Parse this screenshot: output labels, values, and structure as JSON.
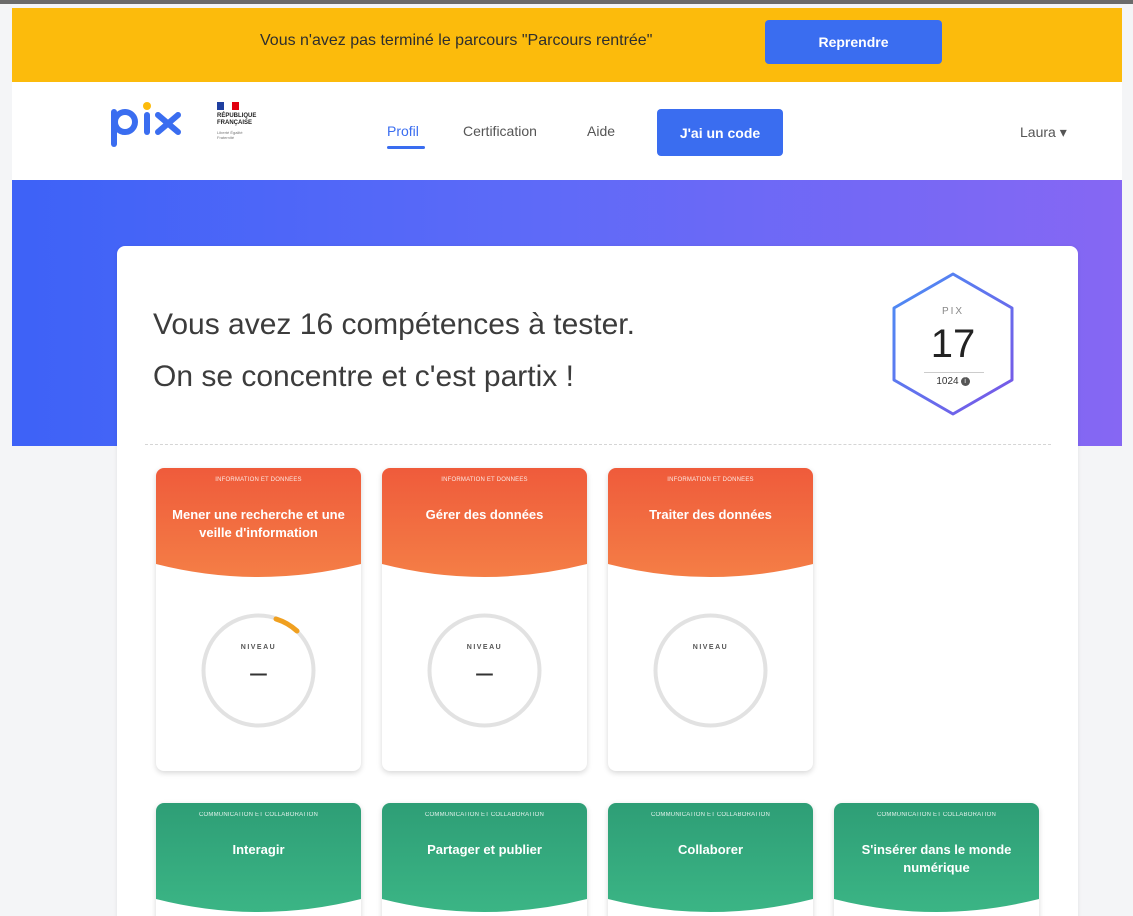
{
  "banner": {
    "message": "Vous n'avez pas terminé le parcours \"Parcours rentrée\"",
    "button": "Reprendre",
    "bg_color": "#fcbb0c"
  },
  "header": {
    "logo": "pix",
    "republic": {
      "line1": "RÉPUBLIQUE",
      "line2": "FRANÇAISE",
      "motto": "Liberté Égalité Fraternité"
    },
    "nav": [
      "Profil",
      "Certification",
      "Aide"
    ],
    "active_nav": "Profil",
    "code_button": "J'ai un code",
    "user": "Laura ▾",
    "accent": "#3a6df0"
  },
  "profile": {
    "intro_line1": "Vous avez 16 compétences à tester.",
    "intro_line2": "On se concentre et c'est partix !",
    "score_label": "PIX",
    "score_value": "17",
    "score_max": "1024",
    "info_icon": "info-icon"
  },
  "competences": [
    {
      "domain": "INFORMATION ET DONNÉES",
      "title": "Mener une recherche et une veille d'information",
      "niveau_label": "NIVEAU",
      "level": "–",
      "progress": 0.1,
      "color": "#f1623e"
    },
    {
      "domain": "INFORMATION ET DONNÉES",
      "title": "Gérer des données",
      "niveau_label": "NIVEAU",
      "level": "–",
      "progress": 0,
      "color": "#f1623e"
    },
    {
      "domain": "INFORMATION ET DONNÉES",
      "title": "Traiter des données",
      "niveau_label": "NIVEAU",
      "level": "",
      "progress": 0,
      "color": "#f1623e"
    },
    {
      "domain": "COMMUNICATION ET COLLABORATION",
      "title": "Interagir",
      "color": "#31a679"
    },
    {
      "domain": "COMMUNICATION ET COLLABORATION",
      "title": "Partager et publier",
      "color": "#31a679"
    },
    {
      "domain": "COMMUNICATION ET COLLABORATION",
      "title": "Collaborer",
      "color": "#31a679"
    },
    {
      "domain": "COMMUNICATION ET COLLABORATION",
      "title": "S'insérer dans le monde numérique",
      "color": "#31a679"
    }
  ]
}
